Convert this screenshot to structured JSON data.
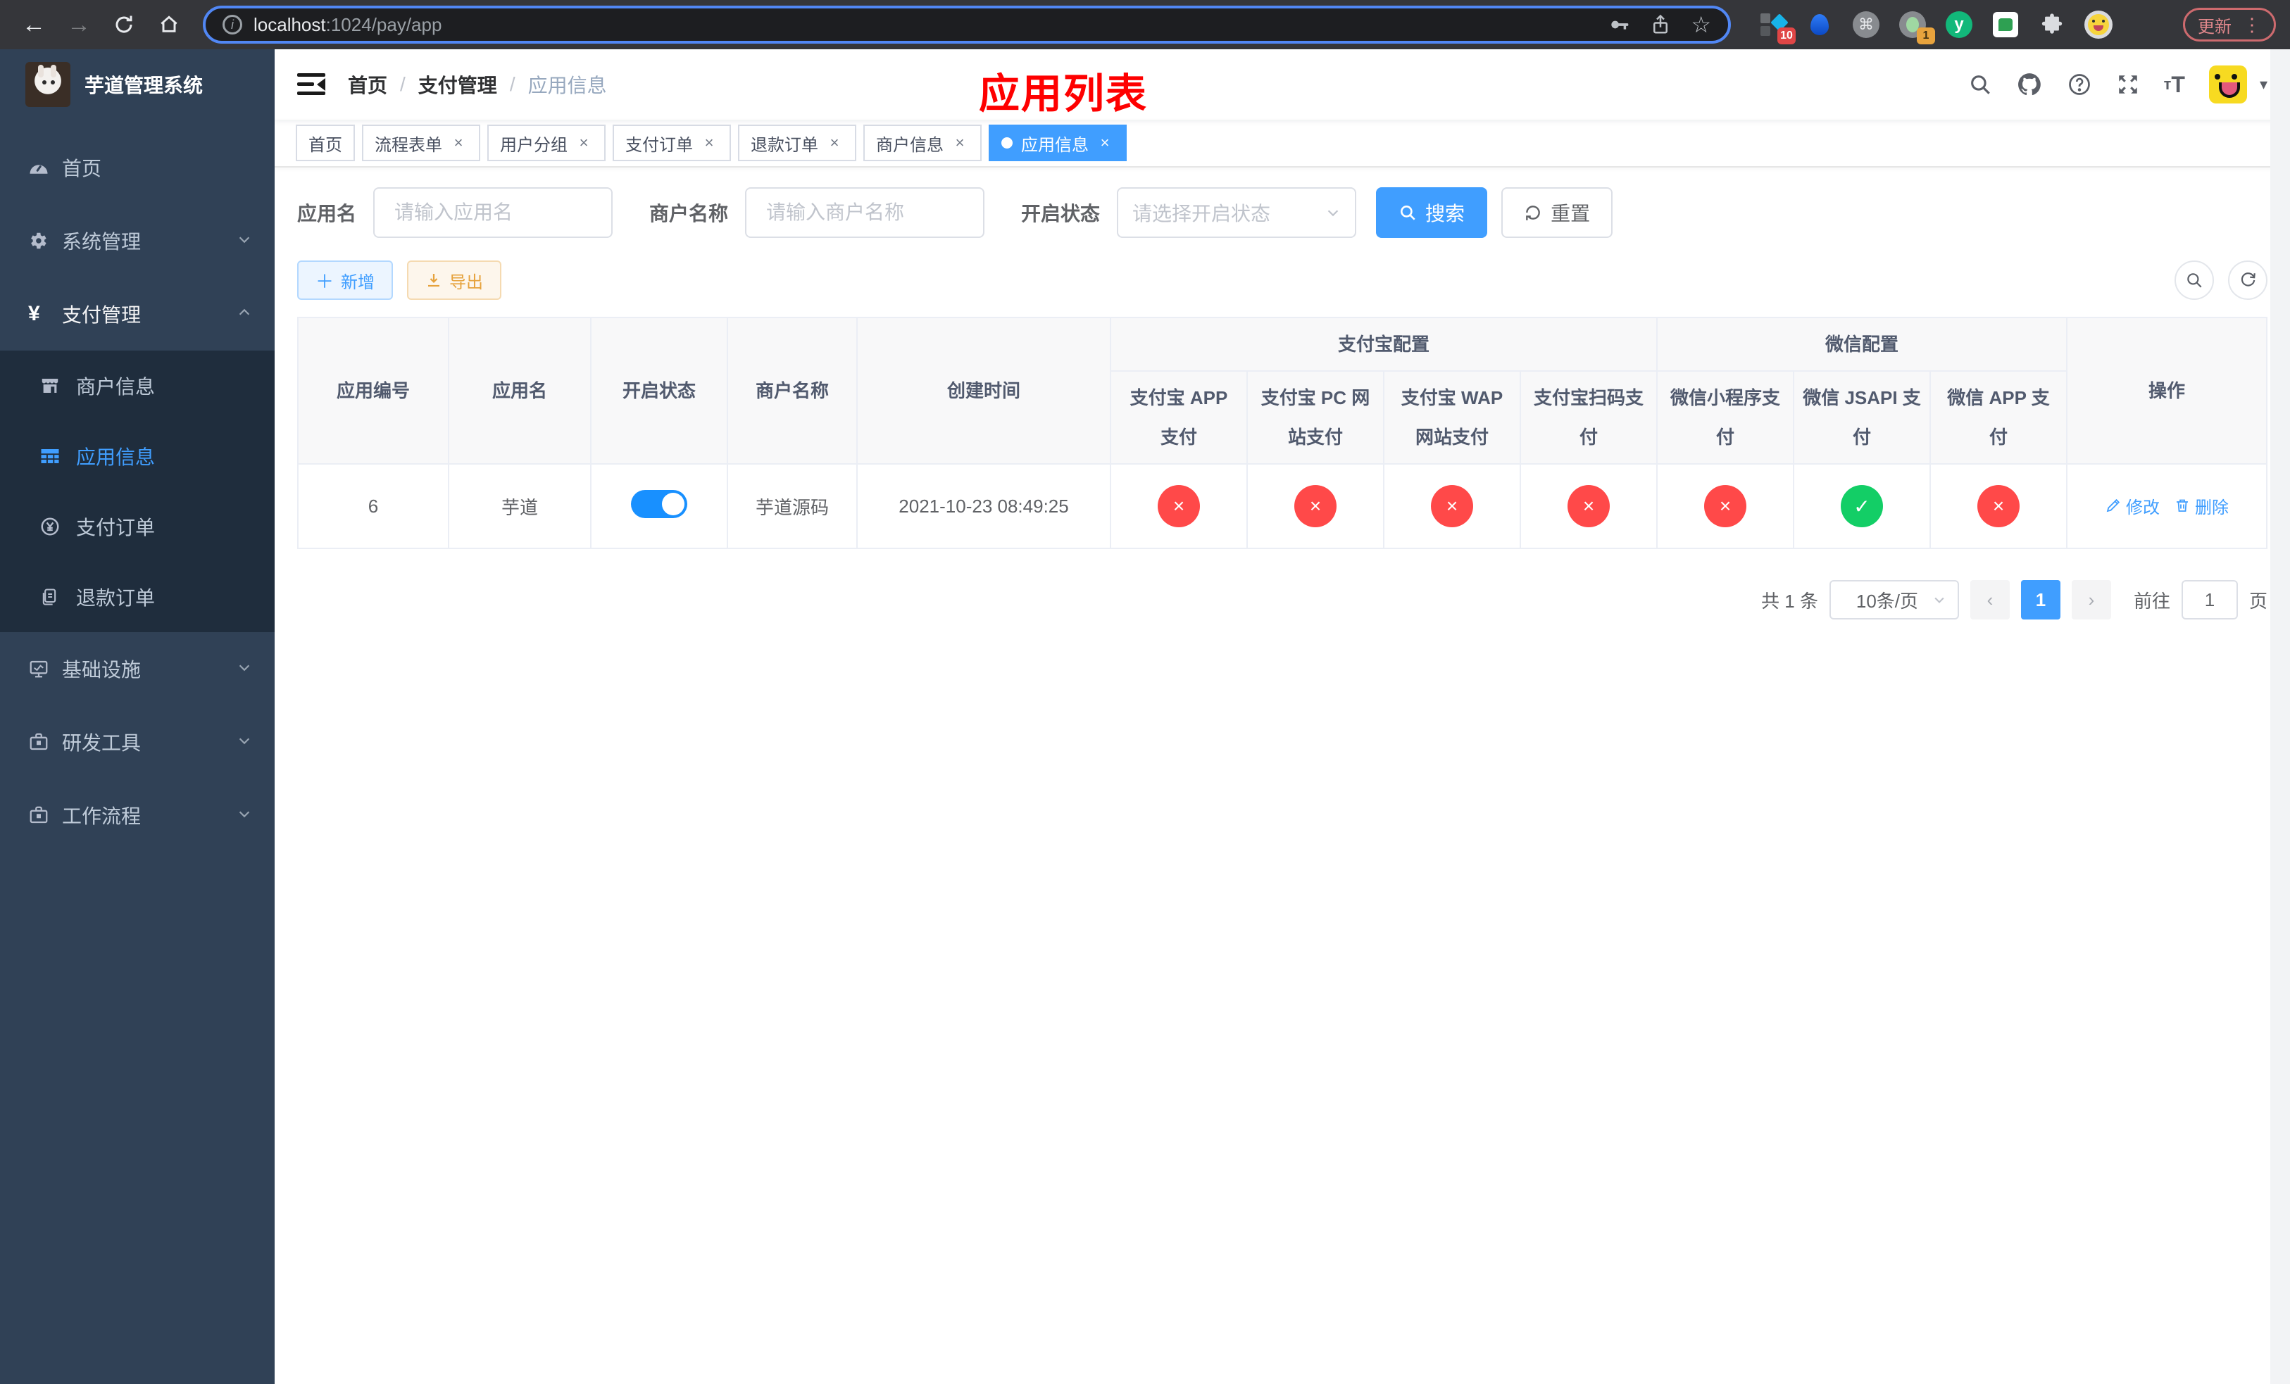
{
  "browser": {
    "url_host": "localhost",
    "url_rest": ":1024/pay/app",
    "update_label": "更新",
    "ext_badge_blocker": "10",
    "ext_badge_green": "1",
    "ext_y_letter": "y"
  },
  "sidebar": {
    "logo_title": "芋道管理系统",
    "menu_home": "首页",
    "menu_system": "系统管理",
    "menu_pay": "支付管理",
    "sub_merchant": "商户信息",
    "sub_app": "应用信息",
    "sub_order": "支付订单",
    "sub_refund": "退款订单",
    "menu_infra": "基础设施",
    "menu_tool": "研发工具",
    "menu_flow": "工作流程"
  },
  "navbar": {
    "breadcrumb": [
      {
        "label": "首页"
      },
      {
        "label": "支付管理"
      },
      {
        "label": "应用信息"
      }
    ],
    "separator": "/",
    "page_title": "应用列表"
  },
  "tags": [
    {
      "label": "首页",
      "closable": false,
      "active": false
    },
    {
      "label": "流程表单",
      "closable": true,
      "active": false
    },
    {
      "label": "用户分组",
      "closable": true,
      "active": false
    },
    {
      "label": "支付订单",
      "closable": true,
      "active": false
    },
    {
      "label": "退款订单",
      "closable": true,
      "active": false
    },
    {
      "label": "商户信息",
      "closable": true,
      "active": false
    },
    {
      "label": "应用信息",
      "closable": true,
      "active": true
    }
  ],
  "filters": {
    "app_name_label": "应用名",
    "app_name_placeholder": "请输入应用名",
    "merchant_label": "商户名称",
    "merchant_placeholder": "请输入商户名称",
    "status_label": "开启状态",
    "status_placeholder": "请选择开启状态",
    "search_label": "搜索",
    "reset_label": "重置"
  },
  "toolbar": {
    "add_label": "新增",
    "export_label": "导出"
  },
  "table": {
    "group_alipay": "支付宝配置",
    "group_wechat": "微信配置",
    "col_id": "应用编号",
    "col_name": "应用名",
    "col_status": "开启状态",
    "col_merchant": "商户名称",
    "col_created": "创建时间",
    "col_alipay_app": "支付宝 APP 支付",
    "col_alipay_pc": "支付宝 PC 网站支付",
    "col_alipay_wap": "支付宝 WAP 网站支付",
    "col_alipay_qr": "支付宝扫码支付",
    "col_wx_mini": "微信小程序支付",
    "col_wx_jsapi": "微信 JSAPI 支付",
    "col_wx_app": "微信 APP 支付",
    "col_actions": "操作",
    "row": {
      "id": "6",
      "name": "芋道",
      "enabled": true,
      "merchant": "芋道源码",
      "created_at": "2021-10-23 08:49:25",
      "pay_status": [
        false,
        false,
        false,
        false,
        false,
        true,
        false
      ],
      "edit_label": "修改",
      "delete_label": "删除"
    }
  },
  "pagination": {
    "total_text": "共 1 条",
    "page_size": "10条/页",
    "current_page": "1",
    "goto_label": "前往",
    "goto_value": "1",
    "page_suffix": "页"
  },
  "icons": {
    "check": "✓",
    "cross": "×",
    "close": "×"
  },
  "colors": {
    "primary": "#409eff",
    "danger": "#ff4949",
    "success": "#13ce66",
    "switch_on": "#1890ff",
    "sidebar_bg": "#304156",
    "submenu_bg": "#1f2d3d",
    "title_red": "#fe0000"
  }
}
